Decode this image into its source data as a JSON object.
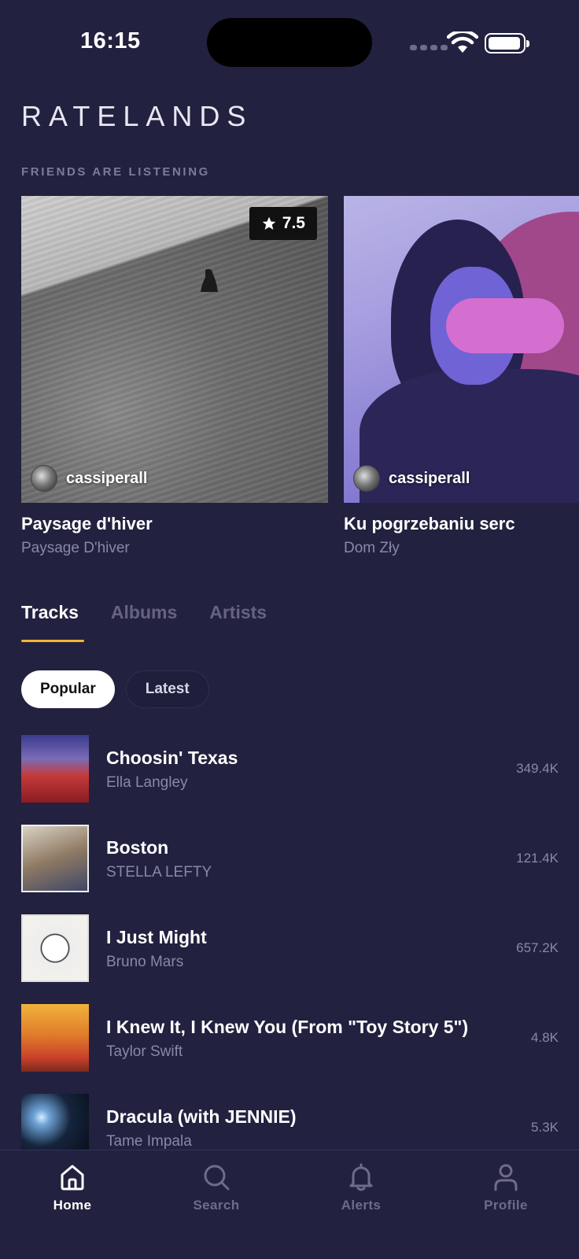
{
  "status_bar": {
    "time": "16:15"
  },
  "app": {
    "brand": "RATELANDS"
  },
  "friends_section": {
    "label": "FRIENDS ARE LISTENING",
    "cards": [
      {
        "title": "Paysage d'hiver",
        "artist": "Paysage D'hiver",
        "friend": "cassiperall",
        "rating": "7.5"
      },
      {
        "title": "Ku pogrzebaniu serc",
        "artist": "Dom Zły",
        "friend": "cassiperall"
      }
    ]
  },
  "tabs": [
    {
      "label": "Tracks",
      "active": true
    },
    {
      "label": "Albums",
      "active": false
    },
    {
      "label": "Artists",
      "active": false
    }
  ],
  "chips": [
    {
      "label": "Popular",
      "active": true
    },
    {
      "label": "Latest",
      "active": false
    }
  ],
  "tracks": [
    {
      "title": "Choosin' Texas",
      "artist": "Ella Langley",
      "count": "349.4K"
    },
    {
      "title": "Boston",
      "artist": "STELLA LEFTY",
      "count": "121.4K"
    },
    {
      "title": "I Just Might",
      "artist": "Bruno Mars",
      "count": "657.2K"
    },
    {
      "title": "I Knew It, I Knew You (From \"Toy Story 5\")",
      "artist": "Taylor Swift",
      "count": "4.8K"
    },
    {
      "title": "Dracula (with JENNIE)",
      "artist": "Tame Impala",
      "count": "5.3K"
    }
  ],
  "bottom_nav": [
    {
      "label": "Home",
      "icon": "home-icon",
      "active": true
    },
    {
      "label": "Search",
      "icon": "search-icon",
      "active": false
    },
    {
      "label": "Alerts",
      "icon": "bell-icon",
      "active": false
    },
    {
      "label": "Profile",
      "icon": "person-icon",
      "active": false
    }
  ],
  "colors": {
    "background": "#22213f",
    "accent": "#f2b634",
    "muted_text": "#8a88a6",
    "inactive_tab": "#65637f"
  }
}
